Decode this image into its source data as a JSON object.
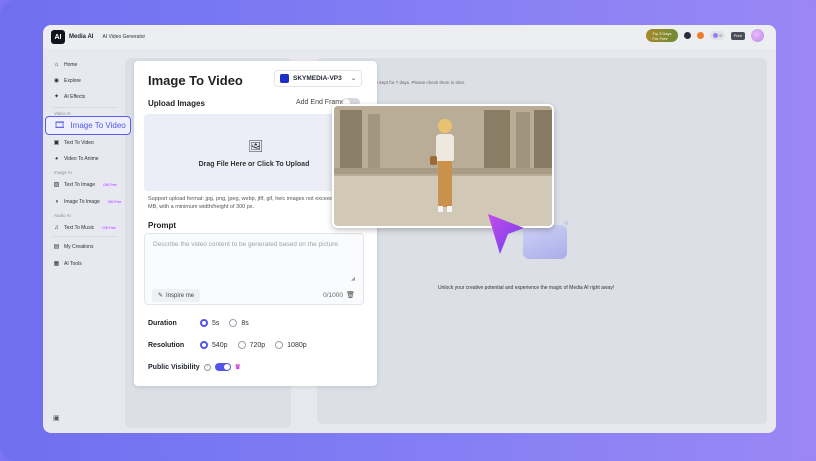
{
  "app": {
    "brand": "Media AI",
    "crumb": "AI Video Generator"
  },
  "topbar": {
    "try_line1": "Try 3 Days",
    "try_line2": "For Free",
    "pill_value": "0",
    "free_label": "Free"
  },
  "sidebar": {
    "items": [
      {
        "label": "Home",
        "icon": "home-icon"
      },
      {
        "label": "Explore",
        "icon": "compass-icon"
      },
      {
        "label": "AI Effects",
        "icon": "sparkle-icon"
      }
    ],
    "group_video": "Video AI",
    "highlight_label": "Image To Video",
    "video_items": [
      {
        "label": "Text To Video"
      },
      {
        "label": "Video To Anime"
      }
    ],
    "group_image": "Image AI",
    "image_items": [
      {
        "label": "Text To Image",
        "tag": "Gift Free"
      },
      {
        "label": "Image To Image",
        "tag": "Gift Free"
      }
    ],
    "group_audio": "Audio AI",
    "audio_items": [
      {
        "label": "Text To Music",
        "tag": "Gift Free"
      }
    ],
    "bottom_items": [
      {
        "label": "My Creations"
      },
      {
        "label": "AI Tools"
      }
    ]
  },
  "panel": {
    "title": "Image To Video",
    "model": "SKYMEDIA-VP3",
    "upload_label": "Upload Images",
    "add_end_frame": "Add End Frame",
    "upload_text": "Drag File Here or Click To Upload",
    "format_note": "Support upload format: jpg, png, jpeg, webp, jfif, gif, heic images not exceeding 10 MB, with a minimum width/height of 300 px.",
    "prompt_label": "Prompt",
    "prompt_placeholder": "Describe the video content to be generated based on the picture",
    "inspire": "Inspire me",
    "count": "0/1000",
    "duration_label": "Duration",
    "duration_options": [
      "5s",
      "8s"
    ],
    "duration_selected": "5s",
    "resolution_label": "Resolution",
    "resolution_options": [
      "540p",
      "720p",
      "1080p"
    ],
    "resolution_selected": "540p",
    "visibility_label": "Public Visibility",
    "visibility_on": true
  },
  "main": {
    "note": "...e kept for 7 days. Please check them in time.",
    "unlock": "Unlock your creative potential and experience the magic of Media AI right away!"
  },
  "colors": {
    "accent": "#5156e8",
    "bg": "#7c74f2"
  }
}
